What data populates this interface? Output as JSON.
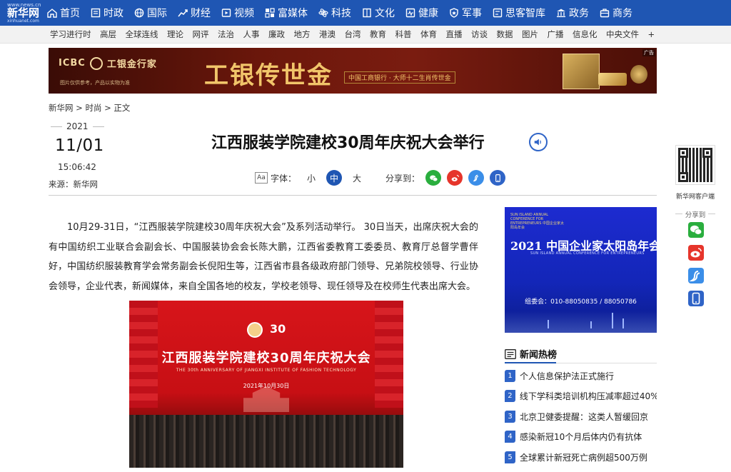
{
  "logo": {
    "line1": "www.news.cn",
    "line2": "新华网",
    "line3": "xinhuanet.com"
  },
  "topnav": [
    {
      "label": "首页",
      "icon": "home-icon"
    },
    {
      "label": "时政",
      "icon": "politics-icon"
    },
    {
      "label": "国际",
      "icon": "globe-icon"
    },
    {
      "label": "财经",
      "icon": "finance-icon"
    },
    {
      "label": "视频",
      "icon": "video-icon"
    },
    {
      "label": "富媒体",
      "icon": "media-icon"
    },
    {
      "label": "科技",
      "icon": "science-icon"
    },
    {
      "label": "文化",
      "icon": "culture-icon"
    },
    {
      "label": "健康",
      "icon": "health-icon"
    },
    {
      "label": "军事",
      "icon": "military-icon"
    },
    {
      "label": "思客智库",
      "icon": "thinktank-icon"
    },
    {
      "label": "政务",
      "icon": "government-icon"
    },
    {
      "label": "商务",
      "icon": "business-icon"
    }
  ],
  "subnav": [
    "学习进行时",
    "高层",
    "全球连线",
    "理论",
    "网评",
    "法治",
    "人事",
    "廉政",
    "地方",
    "港澳",
    "台湾",
    "教育",
    "科普",
    "体育",
    "直播",
    "访谈",
    "数据",
    "图片",
    "广播",
    "信息化",
    "中央文件",
    "+"
  ],
  "banner": {
    "brand": "ICBC",
    "brand_cn": "工银金行家",
    "headline": "工银传世金",
    "tagline": "中国工商银行 · 大师十二生肖传世金",
    "note": "图片仅供参考，产品以实物为准",
    "ad_tag": "广告"
  },
  "breadcrumb": [
    "新华网",
    "时尚",
    "正文"
  ],
  "breadcrumb_sep": ">",
  "date": {
    "year": "2021",
    "day": "11/01",
    "time": "15:06:42"
  },
  "source": "来源：新华网",
  "title": "江西服装学院建校30周年庆祝大会举行",
  "font_controls": {
    "icon_text": "Aa",
    "label": "字体：",
    "small": "小",
    "medium": "中",
    "large": "大"
  },
  "share": {
    "label": "分享到："
  },
  "article": {
    "paragraph": "10月29-31日，“江西服装学院建校30周年庆祝大会”及系列活动举行。 30日当天，出席庆祝大会的有中国纺织工业联合会副会长、中国服装协会会长陈大鹏，江西省委教育工委委员、教育厅总督学曹伴好，中国纺织服装教育学会常务副会长倪阳生等，江西省市县各级政府部门领导、兄弟院校领导、行业协会领导，企业代表，新闻媒体，来自全国各地的校友，学校老领导、现任领导及在校师生代表出席大会。"
  },
  "photo": {
    "title": "江西服装学院建校30周年庆祝大会",
    "subtitle": "THE 30th ANNIVERSARY OF JIANGXI INSTITUTE OF FASHION TECHNOLOGY",
    "date": "2021年10月30日"
  },
  "sidebar": {
    "qr_label": "新华网客户端",
    "share_label": "分享到"
  },
  "conf_ad": {
    "small": "SUN ISLAND ANNUAL CONFERENCE FOR ENTREPRENEURS 中国企业家太阳岛年会",
    "title": "2021 中国企业家太阳岛年会",
    "english": "SUN ISLAND ANNUAL CONFERENCE FOR ENTREPRENEURS",
    "phone": "组委会：010-88050835 / 88050786"
  },
  "hot_news": {
    "title": "新闻热榜",
    "items": [
      {
        "num": "1",
        "text": "个人信息保护法正式施行"
      },
      {
        "num": "2",
        "text": "线下学科类培训机构压减率超过40%"
      },
      {
        "num": "3",
        "text": "北京卫健委提醒：这类人暂缓回京"
      },
      {
        "num": "4",
        "text": "感染新冠10个月后体内仍有抗体"
      },
      {
        "num": "5",
        "text": "全球累计新冠死亡病例超500万例"
      }
    ]
  },
  "colors": {
    "nav_blue": "#1f56b3",
    "accent_blue": "#2f64c7",
    "wechat": "#2aae3e",
    "weibo": "#e6352b",
    "qzone": "#3b8ee8",
    "mobile": "#2f64c7"
  }
}
